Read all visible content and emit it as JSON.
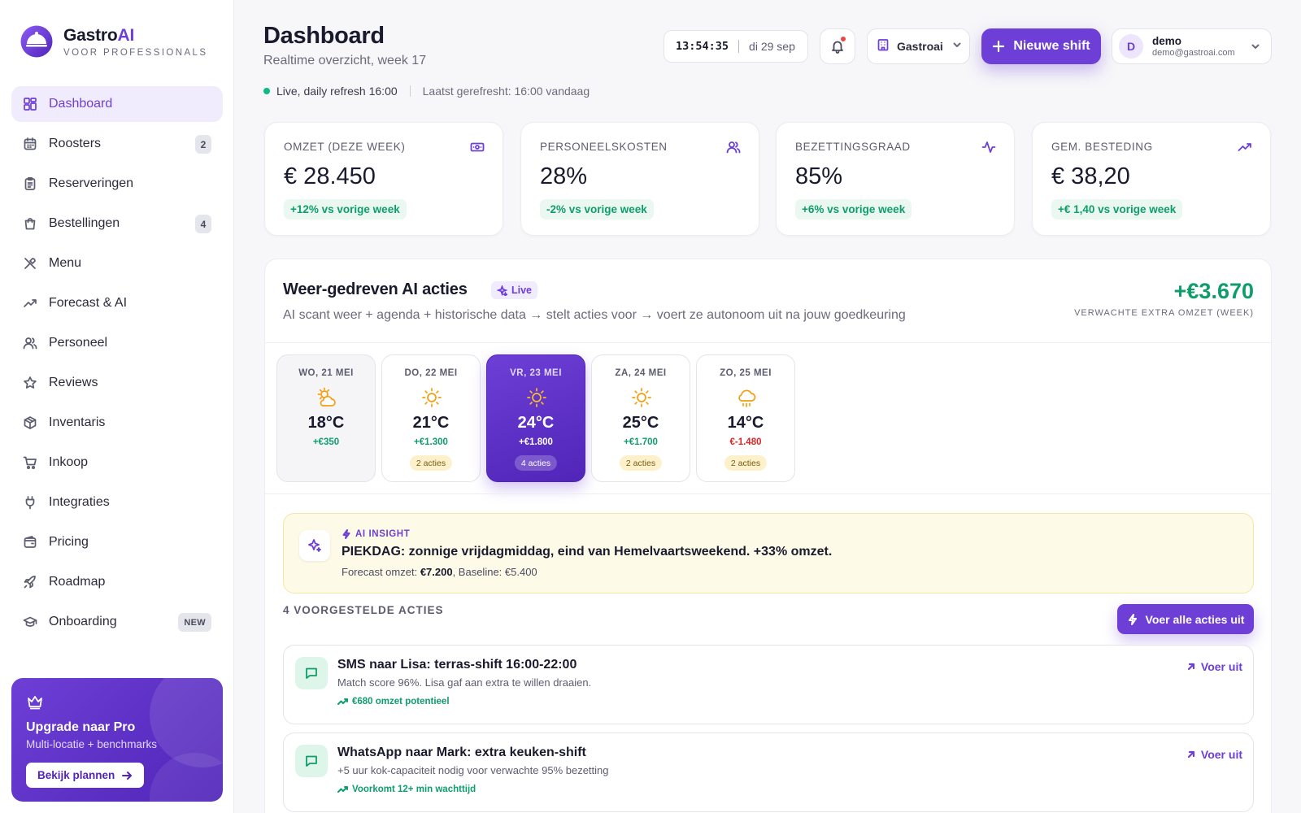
{
  "brand": {
    "name_main": "Gastro",
    "name_accent": "AI",
    "tagline": "VOOR PROFESSIONALS",
    "accent_color": "#6d3fd6"
  },
  "sidebar": {
    "items": [
      {
        "label": "Dashboard",
        "icon": "grid-icon",
        "active": true,
        "badge": ""
      },
      {
        "label": "Roosters",
        "icon": "calendar-icon",
        "badge": "2"
      },
      {
        "label": "Reserveringen",
        "icon": "clipboard-icon",
        "badge": ""
      },
      {
        "label": "Bestellingen",
        "icon": "shopping-bag-icon",
        "badge": "4"
      },
      {
        "label": "Menu",
        "icon": "utensils-icon",
        "badge": ""
      },
      {
        "label": "Forecast & AI",
        "icon": "trending-up-icon",
        "badge": ""
      },
      {
        "label": "Personeel",
        "icon": "users-icon",
        "badge": ""
      },
      {
        "label": "Reviews",
        "icon": "star-icon",
        "badge": ""
      },
      {
        "label": "Inventaris",
        "icon": "package-icon",
        "badge": ""
      },
      {
        "label": "Inkoop",
        "icon": "cart-icon",
        "badge": ""
      },
      {
        "label": "Integraties",
        "icon": "plug-icon",
        "badge": ""
      },
      {
        "label": "Pricing",
        "icon": "wallet-icon",
        "badge": ""
      },
      {
        "label": "Roadmap",
        "icon": "rocket-icon",
        "badge": ""
      },
      {
        "label": "Onboarding",
        "icon": "graduation-cap-icon",
        "badge": "NEW"
      }
    ],
    "upgrade": {
      "title": "Upgrade naar Pro",
      "subtitle": "Multi-locatie + benchmarks",
      "button": "Bekijk plannen"
    }
  },
  "header": {
    "title": "Dashboard",
    "subtitle": "Realtime overzicht, week 17",
    "live_text": "Live, daily refresh 16:00",
    "refresh_text": "Laatst gerefresht: 16:00 vandaag",
    "clock_time": "13:54:35",
    "clock_date": "di 29 sep",
    "org": "Gastroai",
    "new_shift": "Nieuwe shift",
    "user": {
      "initial": "D",
      "name": "demo",
      "email": "demo@gastroai.com"
    },
    "notification_dot_color": "#ef4444"
  },
  "kpis": [
    {
      "label": "OMZET (DEZE WEEK)",
      "value": "€ 28.450",
      "change": "+12% vs vorige week",
      "icon": "banknote-icon"
    },
    {
      "label": "PERSONEELSKOSTEN",
      "value": "28%",
      "change": "-2% vs vorige week",
      "icon": "users-icon"
    },
    {
      "label": "BEZETTINGSGRAAD",
      "value": "85%",
      "change": "+6% vs vorige week",
      "icon": "activity-icon"
    },
    {
      "label": "GEM. BESTEDING",
      "value": "€ 38,20",
      "change": "+€ 1,40 vs vorige week",
      "icon": "trending-up-icon"
    }
  ],
  "weather_panel": {
    "title": "Weer-gedreven AI acties",
    "badge": "Live",
    "subtitle": "AI scant weer + agenda + historische data → stelt acties voor → voert ze autonoom uit na jouw goedkeuring",
    "extra_revenue": "+€3.670",
    "extra_revenue_label": "VERWACHTE EXTRA OMZET (WEEK)",
    "days": [
      {
        "label": "WO, 21 MEI",
        "icon": "cloud-sun-icon",
        "temp": "18°C",
        "delta": "+€350",
        "actions": "",
        "state": "past"
      },
      {
        "label": "DO, 22 MEI",
        "icon": "sun-icon",
        "temp": "21°C",
        "delta": "+€1.300",
        "actions": "2 acties",
        "state": "normal"
      },
      {
        "label": "VR, 23 MEI",
        "icon": "sun-icon",
        "temp": "24°C",
        "delta": "+€1.800",
        "actions": "4 acties",
        "state": "active"
      },
      {
        "label": "ZA, 24 MEI",
        "icon": "sun-icon",
        "temp": "25°C",
        "delta": "+€1.700",
        "actions": "2 acties",
        "state": "normal"
      },
      {
        "label": "ZO, 25 MEI",
        "icon": "cloud-rain-icon",
        "temp": "14°C",
        "delta": "€-1.480",
        "actions": "2 acties",
        "state": "normal",
        "negative": true
      }
    ],
    "insight": {
      "tag": "AI INSIGHT",
      "title": "PIEKDAG: zonnige vrijdagmiddag, eind van Hemelvaartsweekend. +33% omzet.",
      "forecast_label": "Forecast omzet: ",
      "forecast_value": "€7.200",
      "baseline": ", Baseline: €5.400"
    },
    "actions_title": "4 VOORGESTELDE ACTIES",
    "run_all": "Voer alle acties uit",
    "actions": [
      {
        "title": "SMS naar Lisa: terras-shift 16:00-22:00",
        "subtitle": "Match score 96%. Lisa gaf aan extra te willen draaien.",
        "impact": "€680 omzet potentieel",
        "run": "Voer uit"
      },
      {
        "title": "WhatsApp naar Mark: extra keuken-shift",
        "subtitle": "+5 uur kok-capaciteit nodig voor verwachte 95% bezetting",
        "impact": "Voorkomt 12+ min wachttijd",
        "run": "Voer uit"
      }
    ]
  }
}
